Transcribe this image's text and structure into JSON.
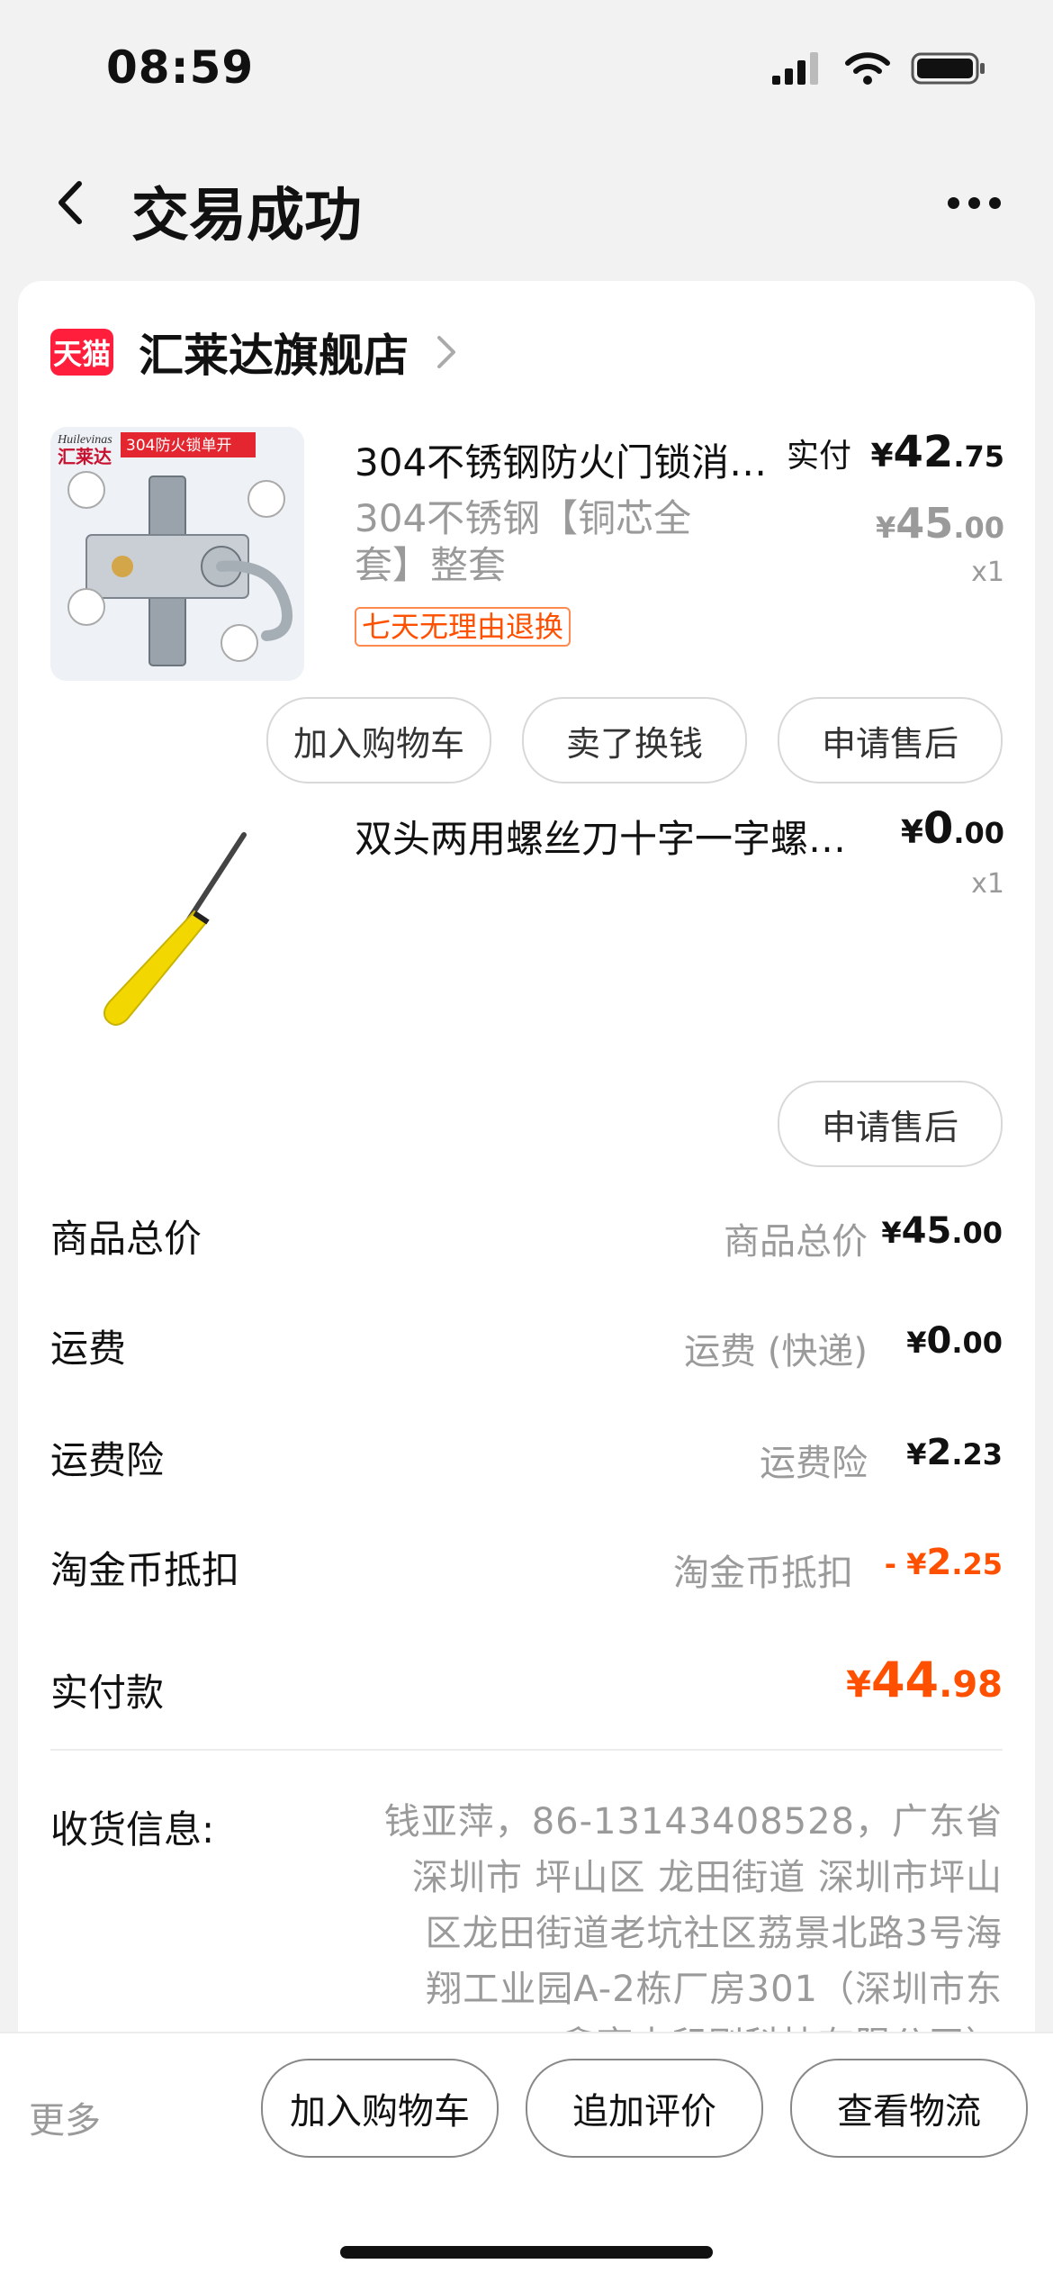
{
  "status_bar": {
    "time": "08:59"
  },
  "nav": {
    "title": "交易成功"
  },
  "shop": {
    "badge": "天猫",
    "name": "汇莱达旗舰店"
  },
  "products": [
    {
      "title": "304不锈钢防火门锁消…",
      "sku": "304不锈钢【铜芯全套】整套",
      "tag": "七天无理由退换",
      "paid_label": "实付",
      "paid_currency": "¥",
      "paid_int": "42",
      "paid_dec": ".75",
      "orig_currency": "¥",
      "orig_int": "45",
      "orig_dec": ".00",
      "qty": "x1",
      "image_text": {
        "brand_en": "Huilevinas",
        "brand_cn": "汇莱达",
        "banner": "304防火锁单开"
      },
      "buttons": [
        "加入购物车",
        "卖了换钱",
        "申请售后"
      ]
    },
    {
      "title": "双头两用螺丝刀十字一字螺…",
      "price_currency": "¥",
      "price_int": "0",
      "price_dec": ".00",
      "qty": "x1",
      "buttons": [
        "申请售后"
      ]
    }
  ],
  "summary": [
    {
      "label": "商品总价",
      "sub": "商品总价",
      "currency": "¥",
      "int": "45",
      "dec": ".00",
      "negative": false
    },
    {
      "label": "运费",
      "sub": "运费 (快递)",
      "currency": "¥",
      "int": "0",
      "dec": ".00",
      "negative": false
    },
    {
      "label": "运费险",
      "sub": "运费险",
      "currency": "¥",
      "int": "2",
      "dec": ".23",
      "negative": false
    },
    {
      "label": "淘金币抵扣",
      "sub": "淘金币抵扣",
      "currency": "- ¥",
      "int": "2",
      "dec": ".25",
      "negative": true
    }
  ],
  "total": {
    "label": "实付款",
    "currency": "¥",
    "int": "44",
    "dec": ".98",
    "color": "#ff5000"
  },
  "address": {
    "label": "收货信息:",
    "lines": [
      "钱亚萍，86-13143408528，广东省",
      "深圳市 坪山区 龙田街道 深圳市坪山",
      "区龙田街道老坑社区荔景北路3号海",
      "翔工业园A-2栋厂房301（深圳市东",
      "鑫奕丰印刷科技有限公司）"
    ]
  },
  "bottom_bar": {
    "more": "更多",
    "buttons": [
      "加入购物车",
      "追加评价",
      "查看物流"
    ]
  },
  "colors": {
    "accent": "#ff5000",
    "tmall_red": "#ff1e3c"
  }
}
